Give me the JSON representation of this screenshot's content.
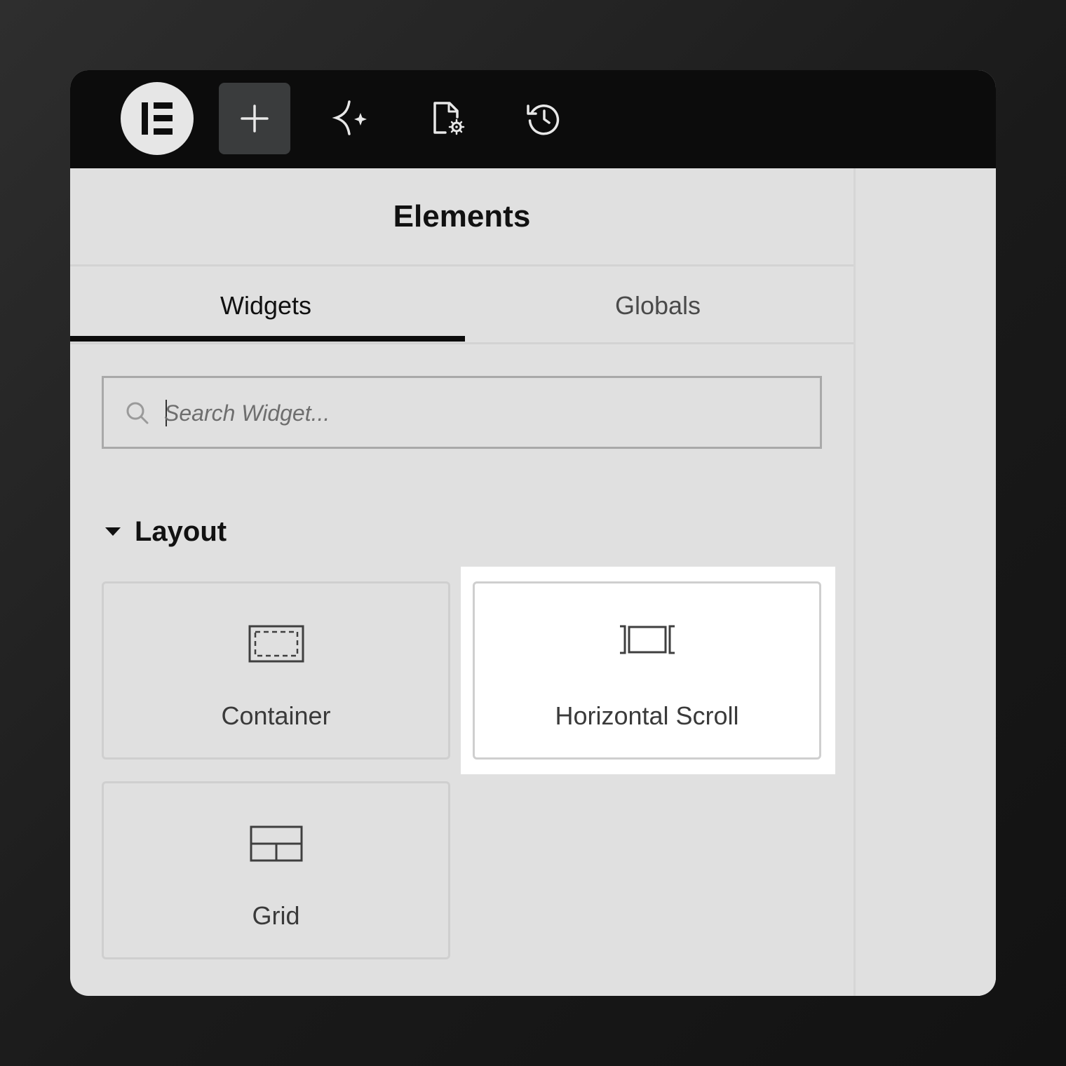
{
  "toolbar": {
    "logo_icon": "elementor-logo-icon",
    "buttons": [
      {
        "name": "add-element",
        "icon": "plus-icon",
        "active": true
      },
      {
        "name": "ai",
        "icon": "sparkle-icon",
        "active": false
      },
      {
        "name": "page-settings",
        "icon": "document-settings-icon",
        "active": false
      },
      {
        "name": "history",
        "icon": "history-icon",
        "active": false
      }
    ]
  },
  "panel": {
    "title": "Elements",
    "tabs": [
      {
        "label": "Widgets",
        "active": true
      },
      {
        "label": "Globals",
        "active": false
      }
    ],
    "search": {
      "placeholder": "Search Widget...",
      "value": ""
    },
    "section": {
      "label": "Layout",
      "widgets": [
        {
          "label": "Container",
          "icon": "container-icon",
          "highlighted": false
        },
        {
          "label": "Horizontal Scroll",
          "icon": "horizontal-scroll-icon",
          "highlighted": true
        },
        {
          "label": "Grid",
          "icon": "grid-icon",
          "highlighted": false
        }
      ]
    }
  },
  "colors": {
    "topbar": "#0c0c0c",
    "panel_bg": "#e0e0e0",
    "highlight": "#ffffff",
    "active_tab_underline": "#0c0c0c"
  }
}
